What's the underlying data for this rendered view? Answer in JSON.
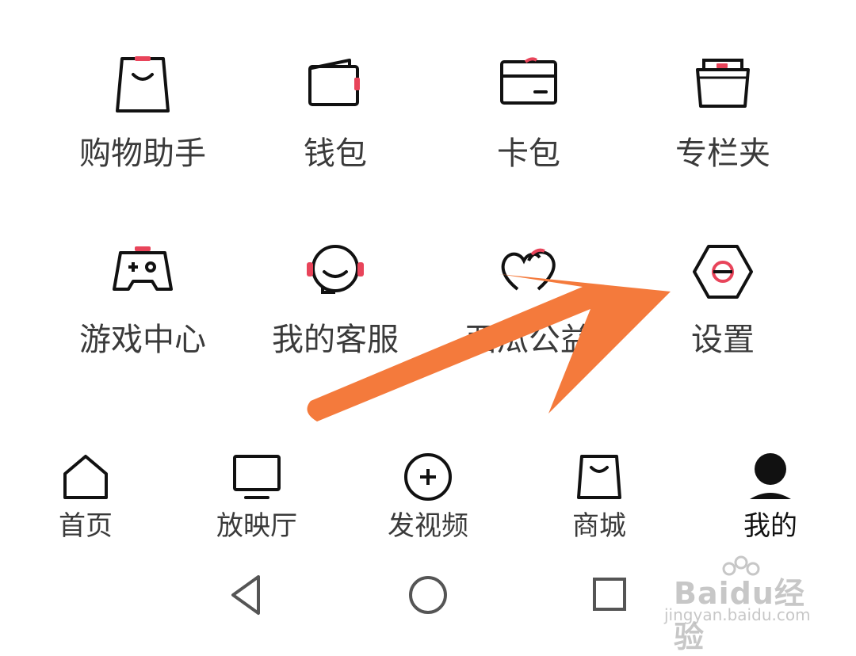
{
  "grid": {
    "row1": [
      {
        "label": "购物助手",
        "icon": "shopping-bag-icon"
      },
      {
        "label": "钱包",
        "icon": "wallet-icon"
      },
      {
        "label": "卡包",
        "icon": "card-icon"
      },
      {
        "label": "专栏夹",
        "icon": "folder-icon"
      }
    ],
    "row2": [
      {
        "label": "游戏中心",
        "icon": "gamepad-icon"
      },
      {
        "label": "我的客服",
        "icon": "headset-icon"
      },
      {
        "label": "西瓜公益",
        "icon": "hearts-icon"
      },
      {
        "label": "设置",
        "icon": "settings-hexagon-icon"
      }
    ]
  },
  "tabbar": {
    "items": [
      {
        "label": "首页",
        "icon": "home-icon"
      },
      {
        "label": "放映厅",
        "icon": "tv-icon"
      },
      {
        "label": "发视频",
        "icon": "plus-circle-icon"
      },
      {
        "label": "商城",
        "icon": "shopping-bag-icon"
      },
      {
        "label": "我的",
        "icon": "user-icon",
        "active": true
      }
    ]
  },
  "watermark": {
    "brand": "Baidu经验",
    "url": "jingyan.baidu.com"
  },
  "colors": {
    "accent": "#e8445a",
    "arrow": "#f47a3c",
    "text": "#3a3a3a"
  }
}
